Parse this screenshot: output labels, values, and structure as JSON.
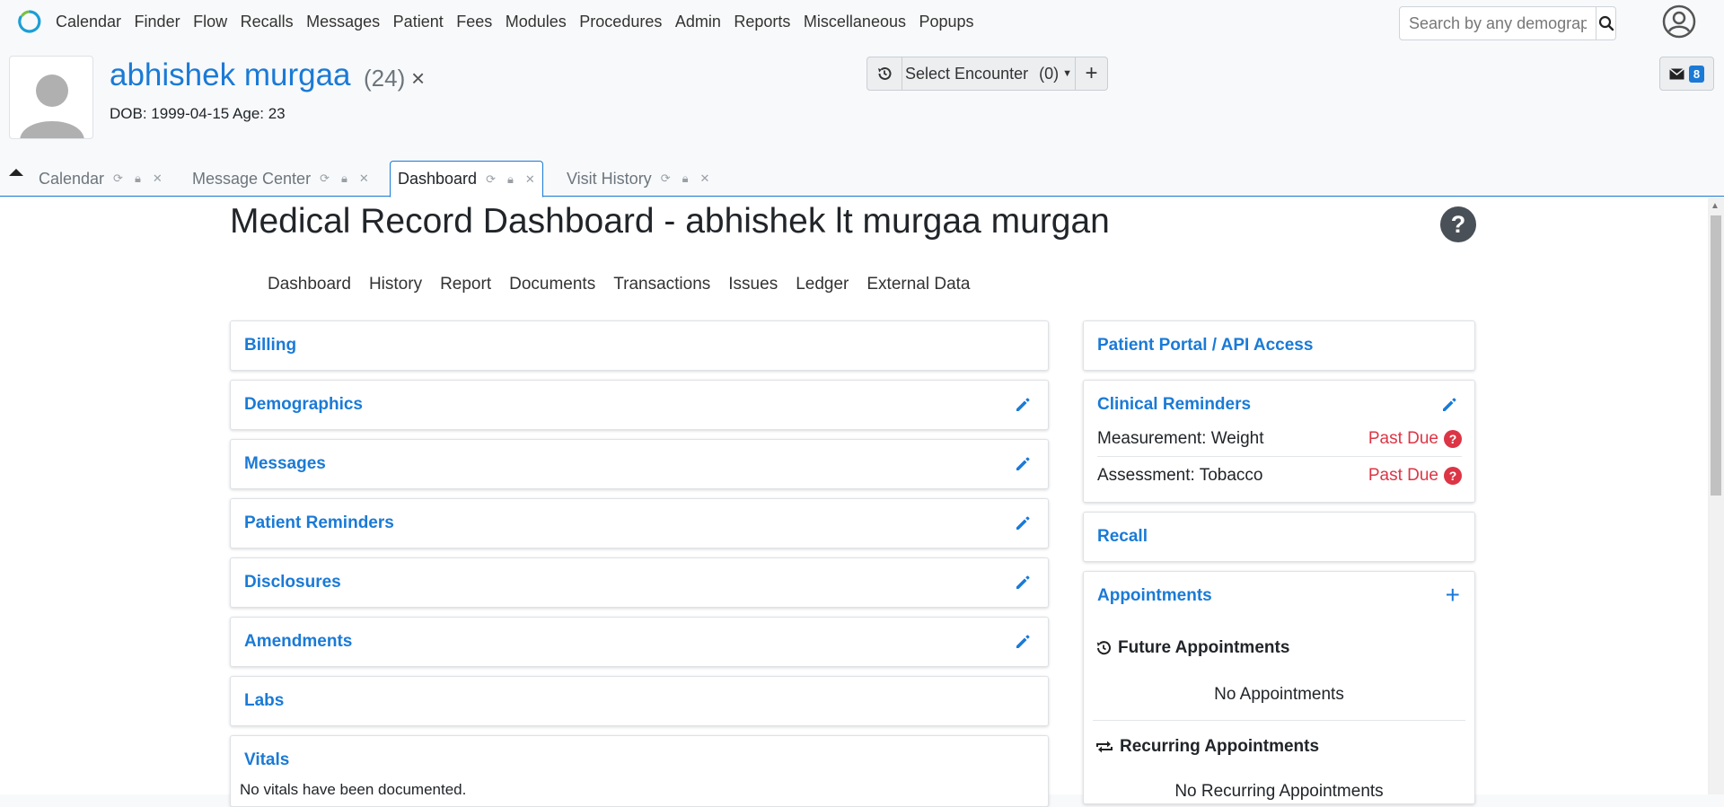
{
  "navbar": {
    "menu": [
      "Calendar",
      "Finder",
      "Flow",
      "Recalls",
      "Messages",
      "Patient",
      "Fees",
      "Modules",
      "Procedures",
      "Admin",
      "Reports",
      "Miscellaneous",
      "Popups"
    ],
    "search_placeholder": "Search by any demographics"
  },
  "patient": {
    "name": "abhishek murgaa",
    "age_paren": "(24)",
    "close": "×",
    "dob_line": "DOB: 1999-04-15 Age: 23"
  },
  "encounter": {
    "select_label": "Select Encounter",
    "count": "(0)",
    "add": "+"
  },
  "messages_badge": "8",
  "tabs": [
    {
      "label": "Calendar",
      "active": false
    },
    {
      "label": "Message Center",
      "active": false
    },
    {
      "label": "Dashboard",
      "active": true
    },
    {
      "label": "Visit History",
      "active": false
    }
  ],
  "page": {
    "title": "Medical Record Dashboard - abhishek lt murgaa murgan",
    "help": "?",
    "subnav": [
      "Dashboard",
      "History",
      "Report",
      "Documents",
      "Transactions",
      "Issues",
      "Ledger",
      "External Data"
    ]
  },
  "left_cards": [
    {
      "title": "Billing",
      "editable": false
    },
    {
      "title": "Demographics",
      "editable": true
    },
    {
      "title": "Messages",
      "editable": true
    },
    {
      "title": "Patient Reminders",
      "editable": true
    },
    {
      "title": "Disclosures",
      "editable": true
    },
    {
      "title": "Amendments",
      "editable": true
    },
    {
      "title": "Labs",
      "editable": false
    },
    {
      "title": "Vitals",
      "editable": false,
      "body": "No vitals have been documented."
    }
  ],
  "right": {
    "portal_title": "Patient Portal / API Access",
    "clinical_reminders": {
      "title": "Clinical Reminders",
      "items": [
        {
          "name": "Measurement: Weight",
          "status": "Past Due"
        },
        {
          "name": "Assessment: Tobacco",
          "status": "Past Due"
        }
      ]
    },
    "recall_title": "Recall",
    "appointments": {
      "title": "Appointments",
      "future_label": "Future Appointments",
      "future_empty": "No Appointments",
      "recurring_label": "Recurring Appointments",
      "recurring_empty": "No Recurring Appointments"
    }
  },
  "colors": {
    "accent": "#1a7ad6",
    "danger": "#dc3545"
  }
}
